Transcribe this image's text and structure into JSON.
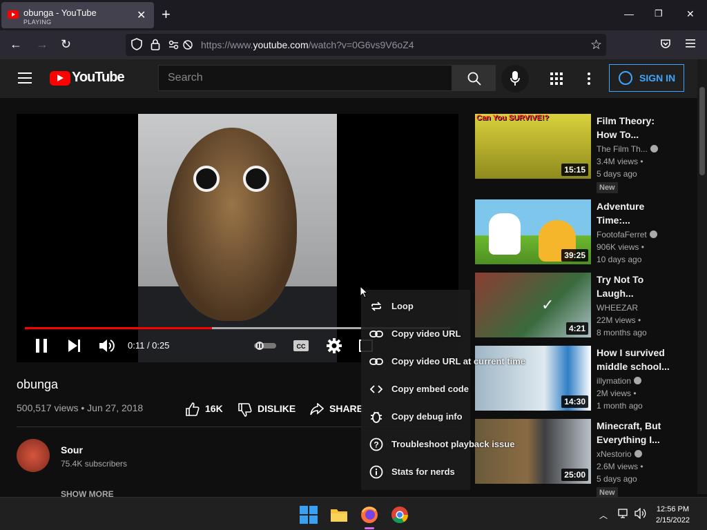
{
  "browser": {
    "tab_title": "obunga - YouTube",
    "tab_status": "PLAYING",
    "url_prefix": "https://www.",
    "url_domain": "youtube.com",
    "url_path": "/watch?v=0G6vs9V6oZ4"
  },
  "header": {
    "logo_text": "YouTube",
    "search_placeholder": "Search",
    "sign_in": "SIGN IN"
  },
  "player": {
    "time": "0:11 / 0:25",
    "progress": 0.44,
    "buffered": 1.0
  },
  "video": {
    "title": "obunga",
    "meta": "500,517 views • Jun 27, 2018",
    "likes": "16K",
    "dislike_label": "DISLIKE",
    "share_label": "SHARE"
  },
  "channel": {
    "name": "Sour",
    "subs": "75.4K subscribers",
    "show_more": "SHOW MORE"
  },
  "context_menu": [
    {
      "label": "Loop",
      "icon": "loop-icon"
    },
    {
      "label": "Copy video URL",
      "icon": "link-icon"
    },
    {
      "label": "Copy video URL at current time",
      "icon": "link-icon"
    },
    {
      "label": "Copy embed code",
      "icon": "code-icon"
    },
    {
      "label": "Copy debug info",
      "icon": "bug-icon"
    },
    {
      "label": "Troubleshoot playback issue",
      "icon": "help-icon"
    },
    {
      "label": "Stats for nerds",
      "icon": "info-icon"
    }
  ],
  "recommended": [
    {
      "title": "Film Theory: How To...",
      "channel": "The Film Th...",
      "views": "3.4M views •",
      "age": "5 days ago",
      "duration": "15:15",
      "badge": "New",
      "thumb_text": "Can You SURVIVE!?"
    },
    {
      "title": "Adventure Time:...",
      "channel": "FootofaFerret",
      "views": "906K views •",
      "age": "10 days ago",
      "duration": "39:25",
      "badge": "",
      "thumb_text": ""
    },
    {
      "title": "Try Not To Laugh...",
      "channel": "WHEEZAR",
      "views": "22M views •",
      "age": "8 months ago",
      "duration": "4:21",
      "badge": "",
      "thumb_text": ""
    },
    {
      "title": "How I survived middle school...",
      "channel": "illymation",
      "views": "2M views •",
      "age": "1 month ago",
      "duration": "14:30",
      "badge": "",
      "thumb_text": ""
    },
    {
      "title": "Minecraft, But Everything I...",
      "channel": "xNestorio",
      "views": "2.6M views •",
      "age": "5 days ago",
      "duration": "25:00",
      "badge": "New",
      "thumb_text": ""
    }
  ],
  "taskbar": {
    "time": "12:56 PM",
    "date": "2/15/2022"
  }
}
